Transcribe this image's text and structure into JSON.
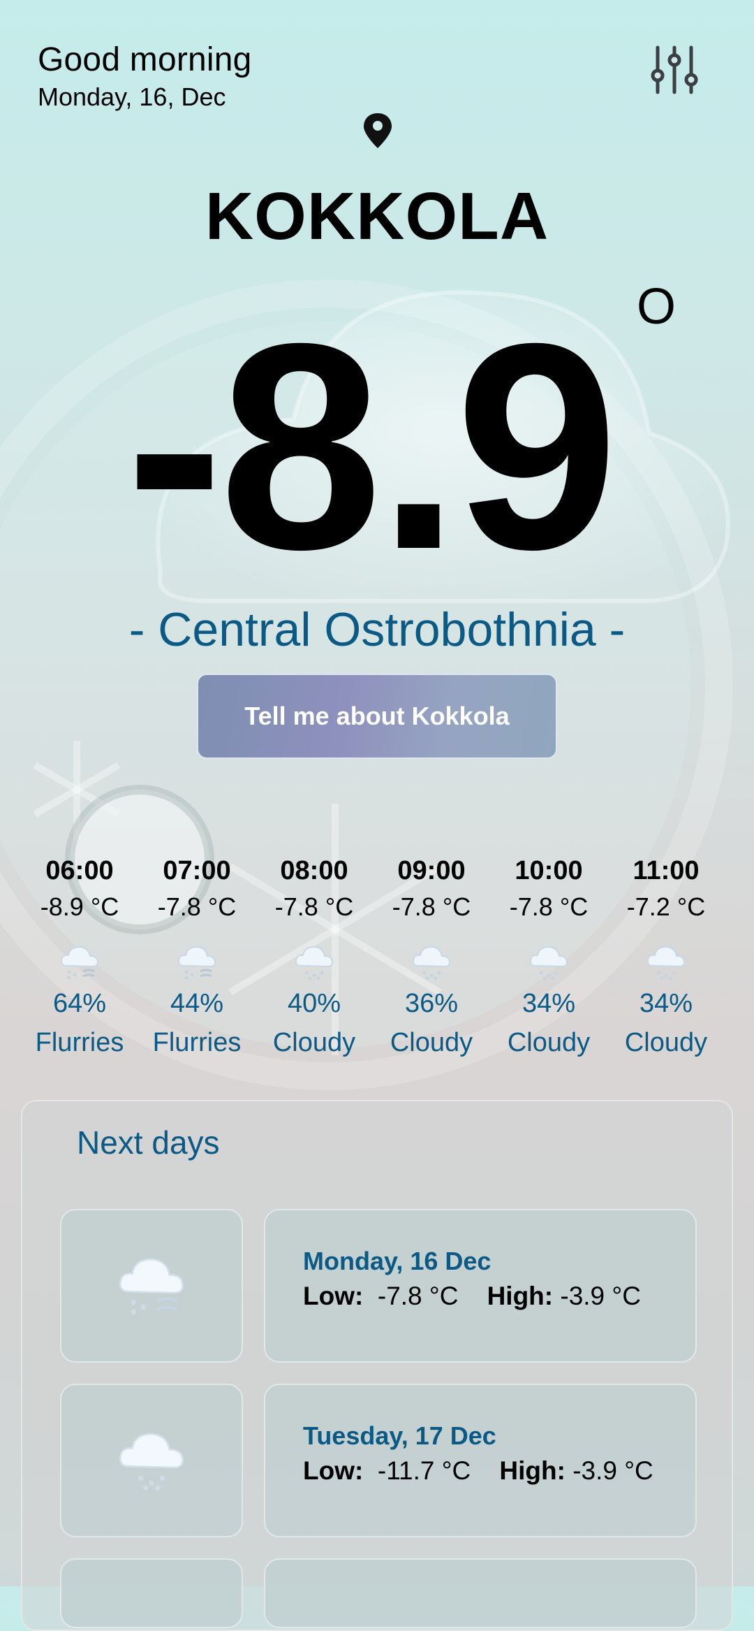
{
  "header": {
    "greeting": "Good morning",
    "date": "Monday, 16, Dec",
    "settings_icon": "sliders-icon"
  },
  "location": {
    "pin_icon": "location-pin-icon",
    "city": "KOKKOLA",
    "region": "- Central Ostrobothnia -"
  },
  "current": {
    "temperature": "-8.9",
    "degree_symbol": "O"
  },
  "tell_button": {
    "label": "Tell me about  Kokkola"
  },
  "hourly": [
    {
      "time": "06:00",
      "temp": "-8.9 °C",
      "icon": "snow-flurries-icon",
      "pct": "64%",
      "desc": "Flurries"
    },
    {
      "time": "07:00",
      "temp": "-7.8 °C",
      "icon": "snow-flurries-icon",
      "pct": "44%",
      "desc": "Flurries"
    },
    {
      "time": "08:00",
      "temp": "-7.8 °C",
      "icon": "snow-cloud-icon",
      "pct": "40%",
      "desc": "Cloudy"
    },
    {
      "time": "09:00",
      "temp": "-7.8 °C",
      "icon": "snow-cloud-icon",
      "pct": "36%",
      "desc": "Cloudy"
    },
    {
      "time": "10:00",
      "temp": "-7.8 °C",
      "icon": "snow-cloud-icon",
      "pct": "34%",
      "desc": "Cloudy"
    },
    {
      "time": "11:00",
      "temp": "-7.2 °C",
      "icon": "snow-cloud-icon",
      "pct": "34%",
      "desc": "Cloudy"
    }
  ],
  "next_days": {
    "title": "Next days",
    "low_label": "Low:",
    "high_label": "High:",
    "days": [
      {
        "name": "Monday, 16 Dec",
        "low": "-7.8 °C",
        "high": "-3.9 °C",
        "icon": "snow-flurries-icon"
      },
      {
        "name": "Tuesday, 17 Dec",
        "low": "-11.7 °C",
        "high": "-3.9 °C",
        "icon": "snow-cloud-icon"
      }
    ]
  },
  "colors": {
    "accent": "#0b5a85",
    "button": "#8e90bd"
  }
}
